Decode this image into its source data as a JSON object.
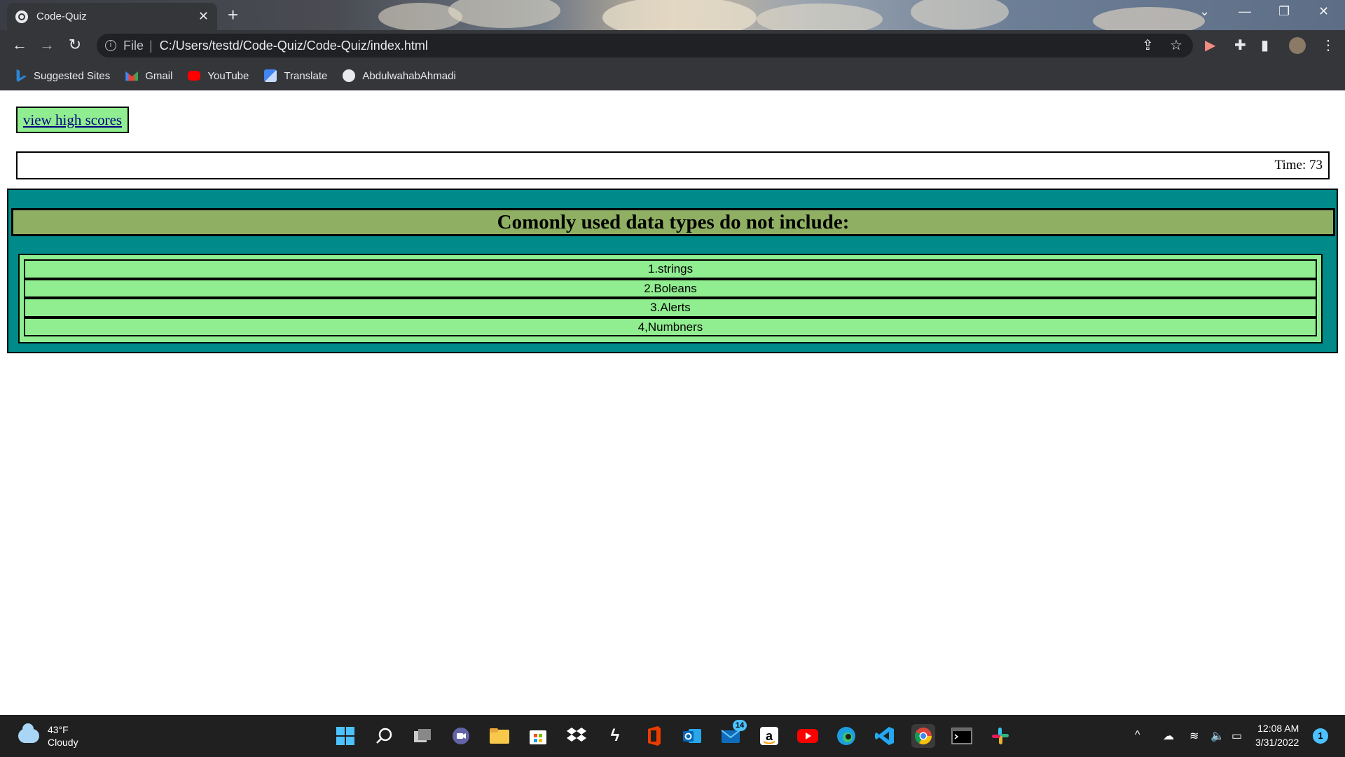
{
  "browser": {
    "tab_title": "Code-Quiz",
    "tab_close": "✕",
    "new_tab": "+",
    "address_scheme": "File",
    "address_url": "C:/Users/testd/Code-Quiz/Code-Quiz/index.html",
    "bookmarks": [
      {
        "label": "Suggested Sites",
        "icon": "bing-icon"
      },
      {
        "label": "Gmail",
        "icon": "gmail-icon"
      },
      {
        "label": "YouTube",
        "icon": "youtube-icon"
      },
      {
        "label": "Translate",
        "icon": "translate-icon"
      },
      {
        "label": "AbdulwahabAhmadi",
        "icon": "globe-icon"
      }
    ]
  },
  "page": {
    "high_scores_link": "view high scores",
    "timer_text": "Time: 73",
    "question": "Comonly used data types do not include:",
    "answers": [
      "1.strings",
      "2.Boleans",
      "3.Alerts",
      "4,Numbners"
    ]
  },
  "taskbar": {
    "weather_temp": "43°F",
    "weather_desc": "Cloudy",
    "clock_time": "12:08 AM",
    "clock_date": "3/31/2022",
    "mail_badge": "14",
    "notification_count": "1"
  },
  "colors": {
    "quiz_bg": "#018a8a",
    "question_bg": "#8fb063",
    "answer_bg": "#90ee90"
  }
}
